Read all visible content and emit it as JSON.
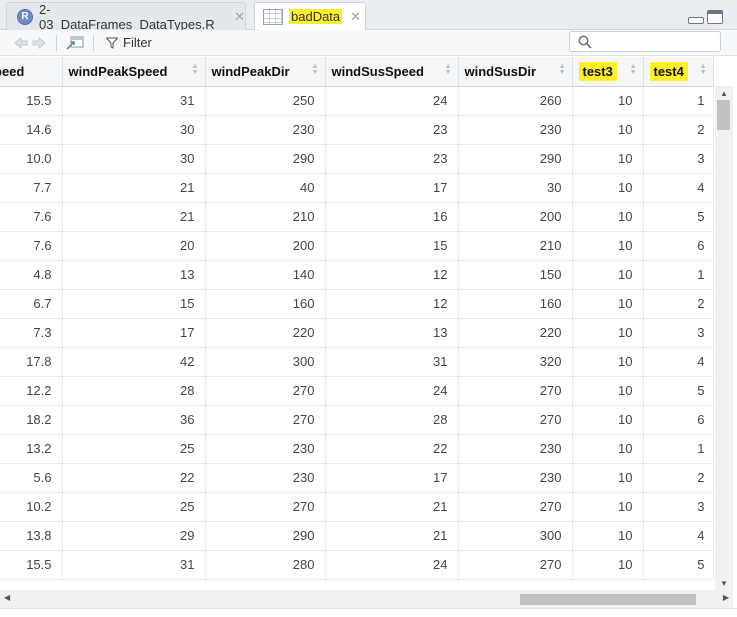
{
  "tabs": [
    {
      "label": "2-03_DataFrames_DataTypes.R",
      "badge": "R",
      "active": false
    },
    {
      "label": "badData",
      "active": true
    }
  ],
  "toolbar": {
    "filter_label": "Filter",
    "search_placeholder": ""
  },
  "colors": {
    "highlight": "#ffef2a",
    "header_bg": "#f4f6f8",
    "tabbar_bg": "#e9edf1"
  },
  "table": {
    "columns": [
      "peed",
      "windPeakSpeed",
      "windPeakDir",
      "windSusSpeed",
      "windSusDir",
      "test3",
      "test4"
    ],
    "highlighted_columns": [
      "test3",
      "test4"
    ],
    "rows": [
      [
        "15.5",
        "31",
        "250",
        "24",
        "260",
        "10",
        "1"
      ],
      [
        "14.6",
        "30",
        "230",
        "23",
        "230",
        "10",
        "2"
      ],
      [
        "10.0",
        "30",
        "290",
        "23",
        "290",
        "10",
        "3"
      ],
      [
        "7.7",
        "21",
        "40",
        "17",
        "30",
        "10",
        "4"
      ],
      [
        "7.6",
        "21",
        "210",
        "16",
        "200",
        "10",
        "5"
      ],
      [
        "7.6",
        "20",
        "200",
        "15",
        "210",
        "10",
        "6"
      ],
      [
        "4.8",
        "13",
        "140",
        "12",
        "150",
        "10",
        "1"
      ],
      [
        "6.7",
        "15",
        "160",
        "12",
        "160",
        "10",
        "2"
      ],
      [
        "7.3",
        "17",
        "220",
        "13",
        "220",
        "10",
        "3"
      ],
      [
        "17.8",
        "42",
        "300",
        "31",
        "320",
        "10",
        "4"
      ],
      [
        "12.2",
        "28",
        "270",
        "24",
        "270",
        "10",
        "5"
      ],
      [
        "18.2",
        "36",
        "270",
        "28",
        "270",
        "10",
        "6"
      ],
      [
        "13.2",
        "25",
        "230",
        "22",
        "230",
        "10",
        "1"
      ],
      [
        "5.6",
        "22",
        "230",
        "17",
        "230",
        "10",
        "2"
      ],
      [
        "10.2",
        "25",
        "270",
        "21",
        "270",
        "10",
        "3"
      ],
      [
        "13.8",
        "29",
        "290",
        "21",
        "300",
        "10",
        "4"
      ],
      [
        "15.5",
        "31",
        "280",
        "24",
        "270",
        "10",
        "5"
      ]
    ]
  }
}
